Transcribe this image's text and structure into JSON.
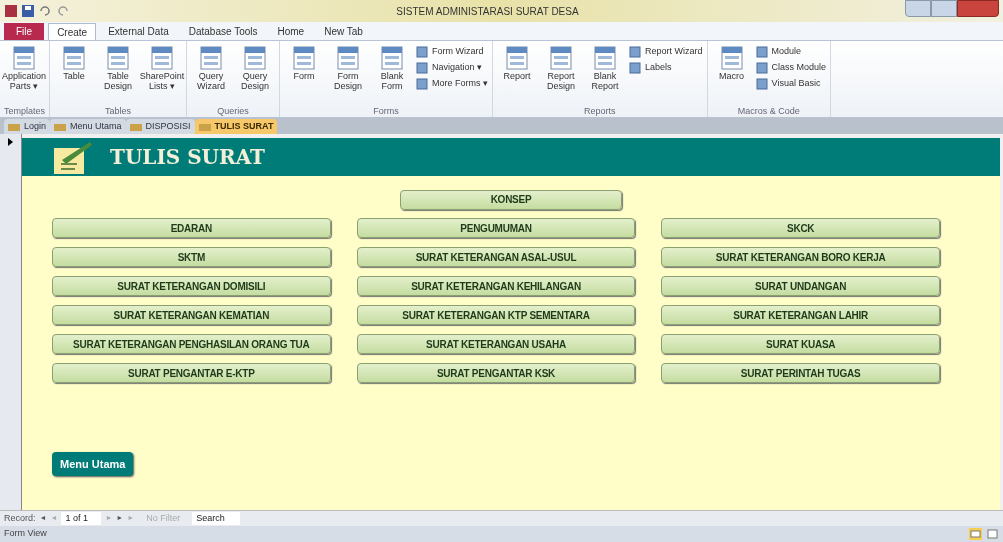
{
  "window": {
    "title": "SISTEM ADMINISTARASI SURAT DESA"
  },
  "ribbon_tabs": [
    {
      "label": "File",
      "kind": "file",
      "selected": false
    },
    {
      "label": "Create",
      "kind": "tab",
      "selected": true
    },
    {
      "label": "External Data",
      "kind": "tab",
      "selected": false
    },
    {
      "label": "Database Tools",
      "kind": "tab",
      "selected": false
    },
    {
      "label": "Home",
      "kind": "tab",
      "selected": false
    },
    {
      "label": "New Tab",
      "kind": "tab",
      "selected": false
    }
  ],
  "ribbon_groups": [
    {
      "label": "Templates",
      "large": [
        {
          "lines": [
            "Application",
            "Parts ▾"
          ]
        }
      ]
    },
    {
      "label": "Tables",
      "large": [
        {
          "lines": [
            "Table"
          ]
        },
        {
          "lines": [
            "Table",
            "Design"
          ]
        },
        {
          "lines": [
            "SharePoint",
            "Lists ▾"
          ]
        }
      ]
    },
    {
      "label": "Queries",
      "large": [
        {
          "lines": [
            "Query",
            "Wizard"
          ]
        },
        {
          "lines": [
            "Query",
            "Design"
          ]
        }
      ]
    },
    {
      "label": "Forms",
      "large": [
        {
          "lines": [
            "Form"
          ]
        },
        {
          "lines": [
            "Form",
            "Design"
          ]
        },
        {
          "lines": [
            "Blank",
            "Form"
          ]
        }
      ],
      "small": [
        "Form Wizard",
        "Navigation ▾",
        "More Forms ▾"
      ]
    },
    {
      "label": "Reports",
      "large": [
        {
          "lines": [
            "Report"
          ]
        },
        {
          "lines": [
            "Report",
            "Design"
          ]
        },
        {
          "lines": [
            "Blank",
            "Report"
          ]
        }
      ],
      "small": [
        "Report Wizard",
        "Labels"
      ]
    },
    {
      "label": "Macros & Code",
      "large": [
        {
          "lines": [
            "Macro"
          ]
        }
      ],
      "small": [
        "Module",
        "Class Module",
        "Visual Basic"
      ]
    }
  ],
  "doc_tabs": [
    {
      "label": "Login",
      "selected": false
    },
    {
      "label": "Menu Utama",
      "selected": false
    },
    {
      "label": "DISPOSISI",
      "selected": false
    },
    {
      "label": "TULIS SURAT",
      "selected": true
    }
  ],
  "form": {
    "title": "TULIS SURAT",
    "top_button": "KONSEP",
    "columns": [
      [
        "EDARAN",
        "SKTM",
        "SURAT KETERANGAN DOMISILI",
        "SURAT KETERANGAN KEMATIAN",
        "SURAT KETERANGAN PENGHASILAN ORANG TUA",
        "SURAT PENGANTAR E-KTP"
      ],
      [
        "PENGUMUMAN",
        "SURAT KETERANGAN ASAL-USUL",
        "SURAT KETERANGAN KEHILANGAN",
        "SURAT KETERANGAN KTP SEMENTARA",
        "SURAT KETERANGAN USAHA",
        "SURAT PENGANTAR KSK"
      ],
      [
        "SKCK",
        "SURAT KETERANGAN BORO KERJA",
        "SURAT UNDANGAN",
        "SURAT KETERANGAN LAHIR",
        "SURAT KUASA",
        "SURAT PERINTAH TUGAS"
      ]
    ],
    "menu_button": "Menu Utama"
  },
  "record_nav": {
    "label": "Record:",
    "first": "◄",
    "prev": "◄",
    "position": "1 of 1",
    "next": "►",
    "last": "►",
    "new": "►",
    "filter": "No Filter",
    "search": "Search"
  },
  "status_bar": {
    "text": "Form View"
  }
}
